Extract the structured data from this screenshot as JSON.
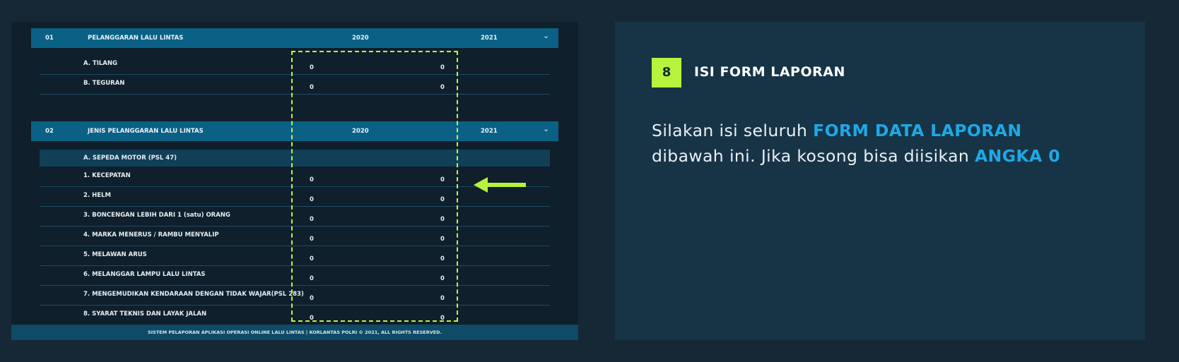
{
  "table": {
    "sections": [
      {
        "num": "01",
        "title": "PELANGGARAN LALU LINTAS",
        "year1": "2020",
        "year2": "2021"
      },
      {
        "num": "02",
        "title": "JENIS PELANGGARAN LALU LINTAS",
        "year1": "2020",
        "year2": "2021"
      }
    ],
    "section1_rows": [
      {
        "label": "A. TILANG",
        "v2020": "0",
        "v2021": "0"
      },
      {
        "label": "B. TEGURAN",
        "v2020": "0",
        "v2021": "0"
      }
    ],
    "subsection": "A. SEPEDA MOTOR (PSL 47)",
    "section2_rows": [
      {
        "label": "1. KECEPATAN",
        "v2020": "0",
        "v2021": "0"
      },
      {
        "label": "2. HELM",
        "v2020": "0",
        "v2021": "0"
      },
      {
        "label": "3. BONCENGAN LEBIH DARI 1 (satu) ORANG",
        "v2020": "0",
        "v2021": "0"
      },
      {
        "label": "4. MARKA MENERUS / RAMBU MENYALIP",
        "v2020": "0",
        "v2021": "0"
      },
      {
        "label": "5. MELAWAN ARUS",
        "v2020": "0",
        "v2021": "0"
      },
      {
        "label": "6. MELANGGAR LAMPU LALU LINTAS",
        "v2020": "0",
        "v2021": "0"
      },
      {
        "label": "7. MENGEMUDIKAN KENDARAAN DENGAN TIDAK WAJAR(PSL 283)",
        "v2020": "0",
        "v2021": "0"
      },
      {
        "label": "8. SYARAT TEKNIS DAN LAYAK JALAN",
        "v2020": "0",
        "v2021": "0"
      }
    ],
    "footer": "SISTEM PELAPORAN APLIKASI OPERASI ONLINE LALU LINTAS | KORLANTAS POLRI © 2021, ALL RIGHTS RESERVED."
  },
  "instruction": {
    "step_number": "8",
    "step_title": "ISI FORM LAPORAN",
    "text_1": "Silakan isi seluruh ",
    "highlight_1": "FORM DATA LAPORAN",
    "text_2": "dibawah ini. Jika kosong bisa diisikan ",
    "highlight_2": "ANGKA 0"
  },
  "colors": {
    "accent_green": "#b7f23c",
    "accent_blue": "#1ea8e6",
    "header_blue": "#0a6185"
  },
  "icons": [
    "chevron-down-icon",
    "arrow-left-icon"
  ]
}
